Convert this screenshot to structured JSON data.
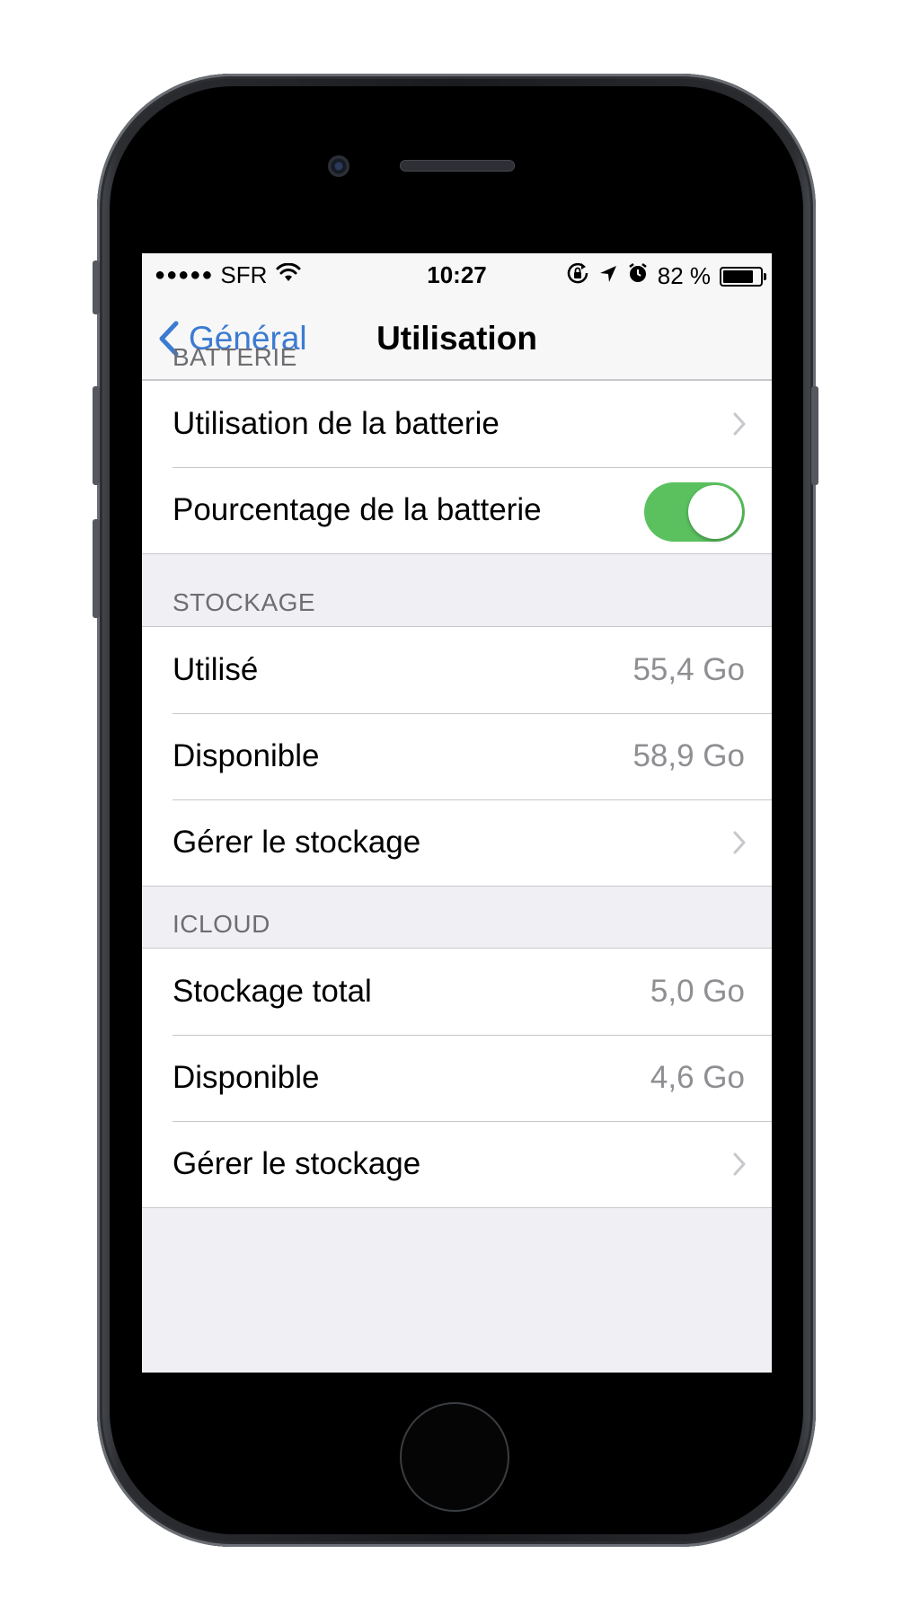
{
  "status_bar": {
    "signal_dots": "●●●●●",
    "carrier": "SFR",
    "wifi_icon": "wifi-icon",
    "time": "10:27",
    "battery_percent": "82 %",
    "battery_level": 0.82
  },
  "navbar": {
    "back_label": "Général",
    "title": "Utilisation"
  },
  "sections": {
    "battery": {
      "header": "BATTERIE",
      "usage_label": "Utilisation de la batterie",
      "percentage_label": "Pourcentage de la batterie",
      "percentage_toggle_on": true
    },
    "storage": {
      "header": "STOCKAGE",
      "used_label": "Utilisé",
      "used_value": "55,4 Go",
      "available_label": "Disponible",
      "available_value": "58,9 Go",
      "manage_label": "Gérer le stockage"
    },
    "icloud": {
      "header": "ICLOUD",
      "total_label": "Stockage total",
      "total_value": "5,0 Go",
      "available_label": "Disponible",
      "available_value": "4,6 Go",
      "manage_label": "Gérer le stockage"
    }
  },
  "colors": {
    "tint": "#3c7bd2",
    "toggle_on": "#5ac15e",
    "group_background": "#efeff4"
  }
}
